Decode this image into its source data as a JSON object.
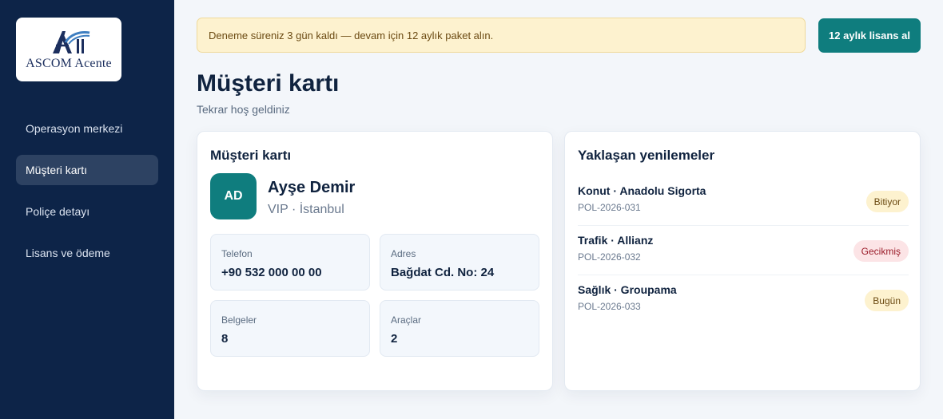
{
  "brand": {
    "logo_text": "ASCOM Acente"
  },
  "sidebar": {
    "items": [
      {
        "label": "Operasyon merkezi"
      },
      {
        "label": "Müşteri kartı"
      },
      {
        "label": "Poliçe detayı"
      },
      {
        "label": "Lisans ve ödeme"
      }
    ],
    "active_index": 1
  },
  "banner": {
    "text": "Deneme süreniz 3 gün kaldı — devam için 12 aylık paket alın.",
    "button_label": "12 aylık lisans al"
  },
  "page": {
    "title": "Müşteri kartı",
    "subtitle": "Tekrar hoş geldiniz"
  },
  "customer_card": {
    "title": "Müşteri kartı",
    "initials": "AD",
    "name": "Ayşe Demir",
    "meta": "VIP · İstanbul",
    "fields": [
      {
        "label": "Telefon",
        "value": "+90 532 000 00 00"
      },
      {
        "label": "Adres",
        "value": "Bağdat Cd. No: 24"
      },
      {
        "label": "Belgeler",
        "value": "8"
      },
      {
        "label": "Araçlar",
        "value": "2"
      }
    ]
  },
  "renewals": {
    "title": "Yaklaşan yenilemeler",
    "items": [
      {
        "title": "Konut · Anadolu Sigorta",
        "code": "POL-2026-031",
        "status": "Bitiyor"
      },
      {
        "title": "Trafik · Allianz",
        "code": "POL-2026-032",
        "status": "Gecikmiş"
      },
      {
        "title": "Sağlık · Groupama",
        "code": "POL-2026-033",
        "status": "Bugün"
      }
    ]
  },
  "colors": {
    "sidebar_bg": "#0d2448",
    "accent": "#0f7d7e",
    "banner_bg": "#fdf2cf",
    "badge_warn_bg": "#fdf2cf",
    "badge_late_bg": "#fce4e6"
  }
}
